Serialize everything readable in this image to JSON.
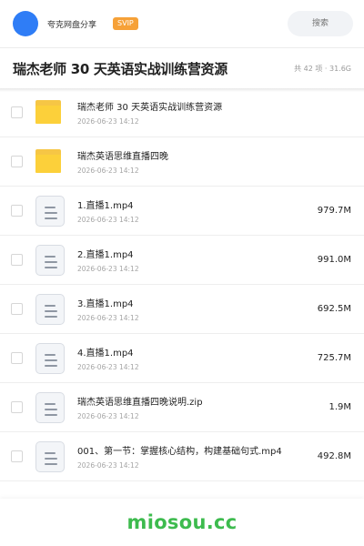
{
  "header": {
    "share_name": "夸克网盘分享",
    "badge": "SVIP",
    "search_placeholder": "搜索"
  },
  "folder": {
    "title": "瑞杰老师 30 天英语实战训练营资源",
    "meta": "共 42 项 · 31.6G"
  },
  "items": [
    {
      "type": "folder",
      "name": "瑞杰老师 30 天英语实战训练营资源",
      "date": "2026-06-23 14:12",
      "size": ""
    },
    {
      "type": "folder",
      "name": "瑞杰英语思维直播四晚",
      "date": "2026-06-23 14:12",
      "size": ""
    },
    {
      "type": "file",
      "name": "1.直播1.mp4",
      "date": "2026-06-23 14:12",
      "size": "979.7M"
    },
    {
      "type": "file",
      "name": "2.直播1.mp4",
      "date": "2026-06-23 14:12",
      "size": "991.0M"
    },
    {
      "type": "file",
      "name": "3.直播1.mp4",
      "date": "2026-06-23 14:12",
      "size": "692.5M"
    },
    {
      "type": "file",
      "name": "4.直播1.mp4",
      "date": "2026-06-23 14:12",
      "size": "725.7M"
    },
    {
      "type": "file",
      "name": "瑞杰英语思维直播四晚说明.zip",
      "date": "2026-06-23 14:12",
      "size": "1.9M"
    },
    {
      "type": "file",
      "name": "001、第一节：掌握核心结构，构建基础句式.mp4",
      "date": "2026-06-23 14:12",
      "size": "492.8M"
    }
  ],
  "watermark": "miosou.cc",
  "colors": {
    "avatar": "#2f7df6",
    "badge": "#f6a138",
    "folder": "#fcd03a",
    "watermark": "#3dbb4e"
  }
}
